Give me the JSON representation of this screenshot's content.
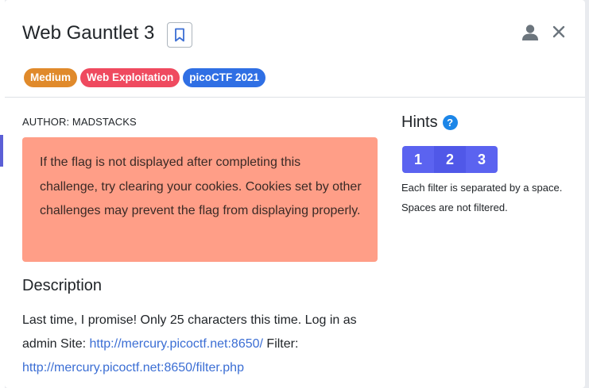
{
  "modal": {
    "title": "Web Gauntlet 3",
    "tags": [
      {
        "label": "Medium",
        "color": "#e08a2b"
      },
      {
        "label": "Web Exploitation",
        "color": "#ef4a5f"
      },
      {
        "label": "picoCTF 2021",
        "color": "#2f6fe4"
      }
    ],
    "author": "AUTHOR: MADSTACKS",
    "alert": "If the flag is not displayed after completing this challenge, try clearing your cookies. Cookies set by other challenges may prevent the flag from displaying properly.",
    "description": {
      "heading": "Description",
      "text_1": "Last time, I promise! Only 25 characters this time. Log in as admin Site: ",
      "link_1": "http://mercury.picoctf.net:8650/",
      "text_2": " Filter: ",
      "link_2": "http://mercury.picoctf.net:8650/filter.php"
    },
    "hints": {
      "heading": "Hints",
      "help_glyph": "?",
      "buttons": [
        "1",
        "2",
        "3"
      ],
      "text": "Each filter is separated by a space. Spaces are not filtered."
    }
  },
  "colors": {
    "accent": "#5b63f0",
    "alert_bg": "#ff9e87",
    "link": "#3b6ed4"
  },
  "icons": [
    "bookmark-icon",
    "user-icon",
    "close-icon",
    "help-icon"
  ]
}
